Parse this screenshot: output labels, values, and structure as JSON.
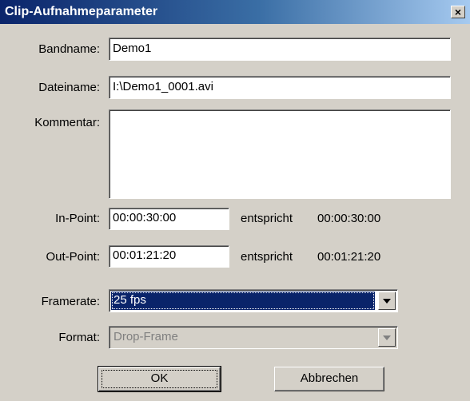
{
  "window": {
    "title": "Clip-Aufnahmeparameter",
    "close_label": "×"
  },
  "fields": {
    "bandname": {
      "label": "Bandname:",
      "value": "Demo1"
    },
    "dateiname": {
      "label": "Dateiname:",
      "value": "I:\\Demo1_0001.avi"
    },
    "kommentar": {
      "label": "Kommentar:",
      "value": ""
    },
    "in_point": {
      "label": "In-Point:",
      "value": "00:00:30:00",
      "equiv_label": "entspricht",
      "equiv_value": "00:00:30:00"
    },
    "out_point": {
      "label": "Out-Point:",
      "value": "00:01:21:20",
      "equiv_label": "entspricht",
      "equiv_value": "00:01:21:20"
    },
    "framerate": {
      "label": "Framerate:",
      "value": "25 fps"
    },
    "format": {
      "label": "Format:",
      "value": "Drop-Frame",
      "enabled": false
    }
  },
  "buttons": {
    "ok": "OK",
    "cancel": "Abbrechen"
  },
  "colors": {
    "titlebar_start": "#0a246a",
    "titlebar_end": "#a6caf0",
    "dialog_bg": "#d4d0c8",
    "selection": "#0a246a"
  }
}
